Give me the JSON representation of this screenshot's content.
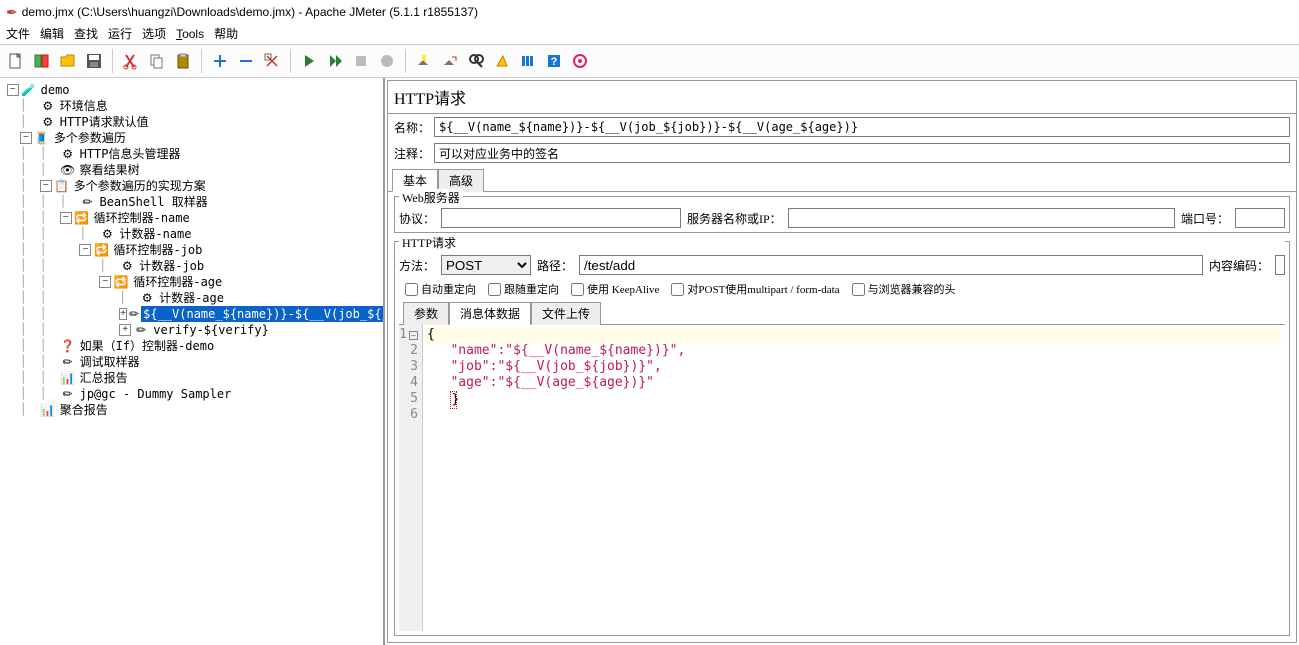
{
  "window": {
    "title": "demo.jmx (C:\\Users\\huangzi\\Downloads\\demo.jmx) - Apache JMeter (5.1.1 r1855137)"
  },
  "menu": [
    "文件",
    "编辑",
    "查找",
    "运行",
    "选项",
    "Tools",
    "帮助"
  ],
  "tree": {
    "n0": "demo",
    "n1": "环境信息",
    "n2": "HTTP请求默认值",
    "n3": "多个参数遍历",
    "n4": "HTTP信息头管理器",
    "n5": "察看结果树",
    "n6": "多个参数遍历的实现方案",
    "n7": "BeanShell 取样器",
    "n8": "循环控制器-name",
    "n9": "计数器-name",
    "n10": "循环控制器-job",
    "n11": "计数器-job",
    "n12": "循环控制器-age",
    "n13": "计数器-age",
    "n14": "${__V(name_${name})}-${__V(job_${job}",
    "n15": "verify-${verify}",
    "n16": "如果（If）控制器-demo",
    "n17": "调试取样器",
    "n18": "汇总报告",
    "n19": "jp@gc - Dummy Sampler",
    "n20": "聚合报告"
  },
  "panel": {
    "title": "HTTP请求",
    "nameLabel": "名称：",
    "nameVal": "${__V(name_${name})}-${__V(job_${job})}-${__V(age_${age})}",
    "commentLabel": "注释：",
    "commentVal": "可以对应业务中的签名",
    "tab_basic": "基本",
    "tab_adv": "高级",
    "webserver": "Web服务器",
    "protoLabel": "协议：",
    "protoVal": "",
    "serverLabel": "服务器名称或IP：",
    "serverVal": "",
    "portLabel": "端口号：",
    "portVal": "",
    "httpreq": "HTTP请求",
    "methodLabel": "方法：",
    "methodVal": "POST",
    "pathLabel": "路径：",
    "pathVal": "/test/add",
    "encLabel": "内容编码：",
    "encVal": "",
    "chk1": "自动重定向",
    "chk2": "跟随重定向",
    "chk3": "使用 KeepAlive",
    "chk4": "对POST使用multipart / form-data",
    "chk5": "与浏览器兼容的头",
    "btab1": "参数",
    "btab2": "消息体数据",
    "btab3": "文件上传",
    "code": {
      "l1": "{",
      "l2a": "   \"name\"",
      "l2b": ":",
      "l2c": "\"${__V(name_${name})}\"",
      "l2d": ",",
      "l3a": "   \"job\"",
      "l3b": ":",
      "l3c": "\"${__V(job_${job})}\"",
      "l3d": ",",
      "l4a": "   \"age\"",
      "l4b": ":",
      "l4c": "\"${__V(age_${age})}\"",
      "l5": "}"
    }
  }
}
